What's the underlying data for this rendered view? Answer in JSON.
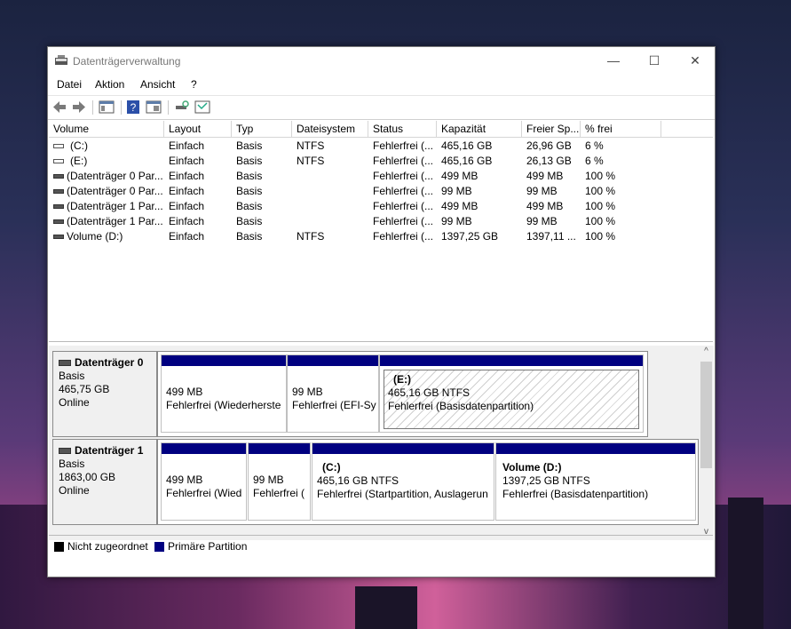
{
  "window": {
    "title": "Datenträgerverwaltung",
    "minimize": "—",
    "maximize": "☐",
    "close": "✕"
  },
  "menu": [
    "Datei",
    "Aktion",
    "Ansicht",
    "?"
  ],
  "toolbar_icons": [
    "back-arrow-icon",
    "forward-arrow-icon",
    "console-tree-icon",
    "help-icon",
    "properties-icon",
    "connect-icon",
    "rescan-icon"
  ],
  "columns": [
    "Volume",
    "Layout",
    "Typ",
    "Dateisystem",
    "Status",
    "Kapazität",
    "Freier Sp...",
    "% frei"
  ],
  "rows": [
    {
      "volume": "(C:)",
      "layout": "Einfach",
      "typ": "Basis",
      "fs": "NTFS",
      "status": "Fehlerfrei (...",
      "cap": "465,16 GB",
      "free": "26,96 GB",
      "pct": "6 %"
    },
    {
      "volume": "(E:)",
      "layout": "Einfach",
      "typ": "Basis",
      "fs": "NTFS",
      "status": "Fehlerfrei (...",
      "cap": "465,16 GB",
      "free": "26,13 GB",
      "pct": "6 %"
    },
    {
      "volume": "(Datenträger 0 Par...",
      "layout": "Einfach",
      "typ": "Basis",
      "fs": "",
      "status": "Fehlerfrei (...",
      "cap": "499 MB",
      "free": "499 MB",
      "pct": "100 %"
    },
    {
      "volume": "(Datenträger 0 Par...",
      "layout": "Einfach",
      "typ": "Basis",
      "fs": "",
      "status": "Fehlerfrei (...",
      "cap": "99 MB",
      "free": "99 MB",
      "pct": "100 %"
    },
    {
      "volume": "(Datenträger 1 Par...",
      "layout": "Einfach",
      "typ": "Basis",
      "fs": "",
      "status": "Fehlerfrei (...",
      "cap": "499 MB",
      "free": "499 MB",
      "pct": "100 %"
    },
    {
      "volume": "(Datenträger 1 Par...",
      "layout": "Einfach",
      "typ": "Basis",
      "fs": "",
      "status": "Fehlerfrei (...",
      "cap": "99 MB",
      "free": "99 MB",
      "pct": "100 %"
    },
    {
      "volume": "Volume (D:)",
      "layout": "Einfach",
      "typ": "Basis",
      "fs": "NTFS",
      "status": "Fehlerfrei (...",
      "cap": "1397,25 GB",
      "free": "1397,11 ...",
      "pct": "100 %"
    }
  ],
  "disks": [
    {
      "name": "Datenträger 0",
      "type": "Basis",
      "size": "465,75 GB",
      "state": "Online",
      "partitions": [
        {
          "title": "",
          "line1": "499 MB",
          "line2": "Fehlerfrei (Wiederherste"
        },
        {
          "title": "",
          "line1": "99 MB",
          "line2": "Fehlerfrei (EFI-Sy"
        },
        {
          "title": "(E:)",
          "line1": "465,16 GB NTFS",
          "line2": "Fehlerfrei (Basisdatenpartition)"
        }
      ]
    },
    {
      "name": "Datenträger 1",
      "type": "Basis",
      "size": "1863,00 GB",
      "state": "Online",
      "partitions": [
        {
          "title": "",
          "line1": "499 MB",
          "line2": "Fehlerfrei (Wied"
        },
        {
          "title": "",
          "line1": "99 MB",
          "line2": "Fehlerfrei ("
        },
        {
          "title": "(C:)",
          "line1": "465,16 GB NTFS",
          "line2": "Fehlerfrei (Startpartition, Auslagerun"
        },
        {
          "title": "Volume  (D:)",
          "line1": "1397,25 GB NTFS",
          "line2": "Fehlerfrei (Basisdatenpartition)"
        }
      ]
    }
  ],
  "legend": {
    "unallocated": "Nicht zugeordnet",
    "primary": "Primäre Partition",
    "unallocated_color": "#000000",
    "primary_color": "#000080"
  },
  "scroll": {
    "up": "^",
    "down": "v"
  }
}
